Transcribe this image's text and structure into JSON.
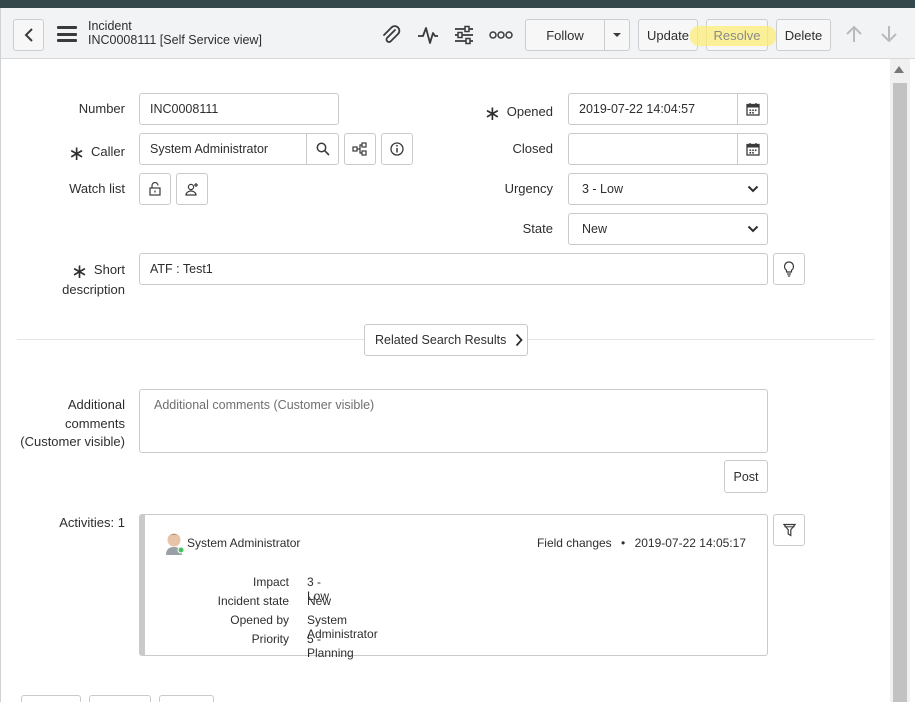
{
  "header": {
    "title": "Incident",
    "subtitle": "INC0008111 [Self Service view]",
    "icons": [
      "paperclip-icon",
      "activity-pulse-icon",
      "sliders-icon",
      "more-options-icon"
    ],
    "follow_label": "Follow",
    "update_label": "Update",
    "resolve_label": "Resolve",
    "delete_label": "Delete",
    "highlight_color": "#fcec78"
  },
  "form": {
    "number": {
      "label": "Number",
      "value": "INC0008111"
    },
    "caller": {
      "label": "Caller",
      "value": "System Administrator"
    },
    "watch_list": {
      "label": "Watch list"
    },
    "opened": {
      "label": "Opened",
      "value": "2019-07-22 14:04:57"
    },
    "closed": {
      "label": "Closed",
      "value": ""
    },
    "urgency": {
      "label": "Urgency",
      "value": "3 - Low"
    },
    "state": {
      "label": "State",
      "value": "New"
    },
    "short_description": {
      "label_line1": "Short",
      "label_line2": "description",
      "value": "ATF : Test1"
    },
    "related_search_label": "Related Search Results",
    "additional_comments": {
      "label_line1": "Additional",
      "label_line2": "comments",
      "label_line3": "(Customer visible)",
      "placeholder": "Additional comments (Customer visible)"
    },
    "post_label": "Post"
  },
  "activities": {
    "label": "Activities: 1",
    "entry": {
      "user": "System Administrator",
      "type": "Field changes",
      "separator": "•",
      "timestamp": "2019-07-22 14:05:17",
      "fields": [
        {
          "key": "Impact",
          "value": "3 - Low"
        },
        {
          "key": "Incident state",
          "value": "New"
        },
        {
          "key": "Opened by",
          "value": "System Administrator"
        },
        {
          "key": "Priority",
          "value": "5 - Planning"
        }
      ]
    }
  }
}
